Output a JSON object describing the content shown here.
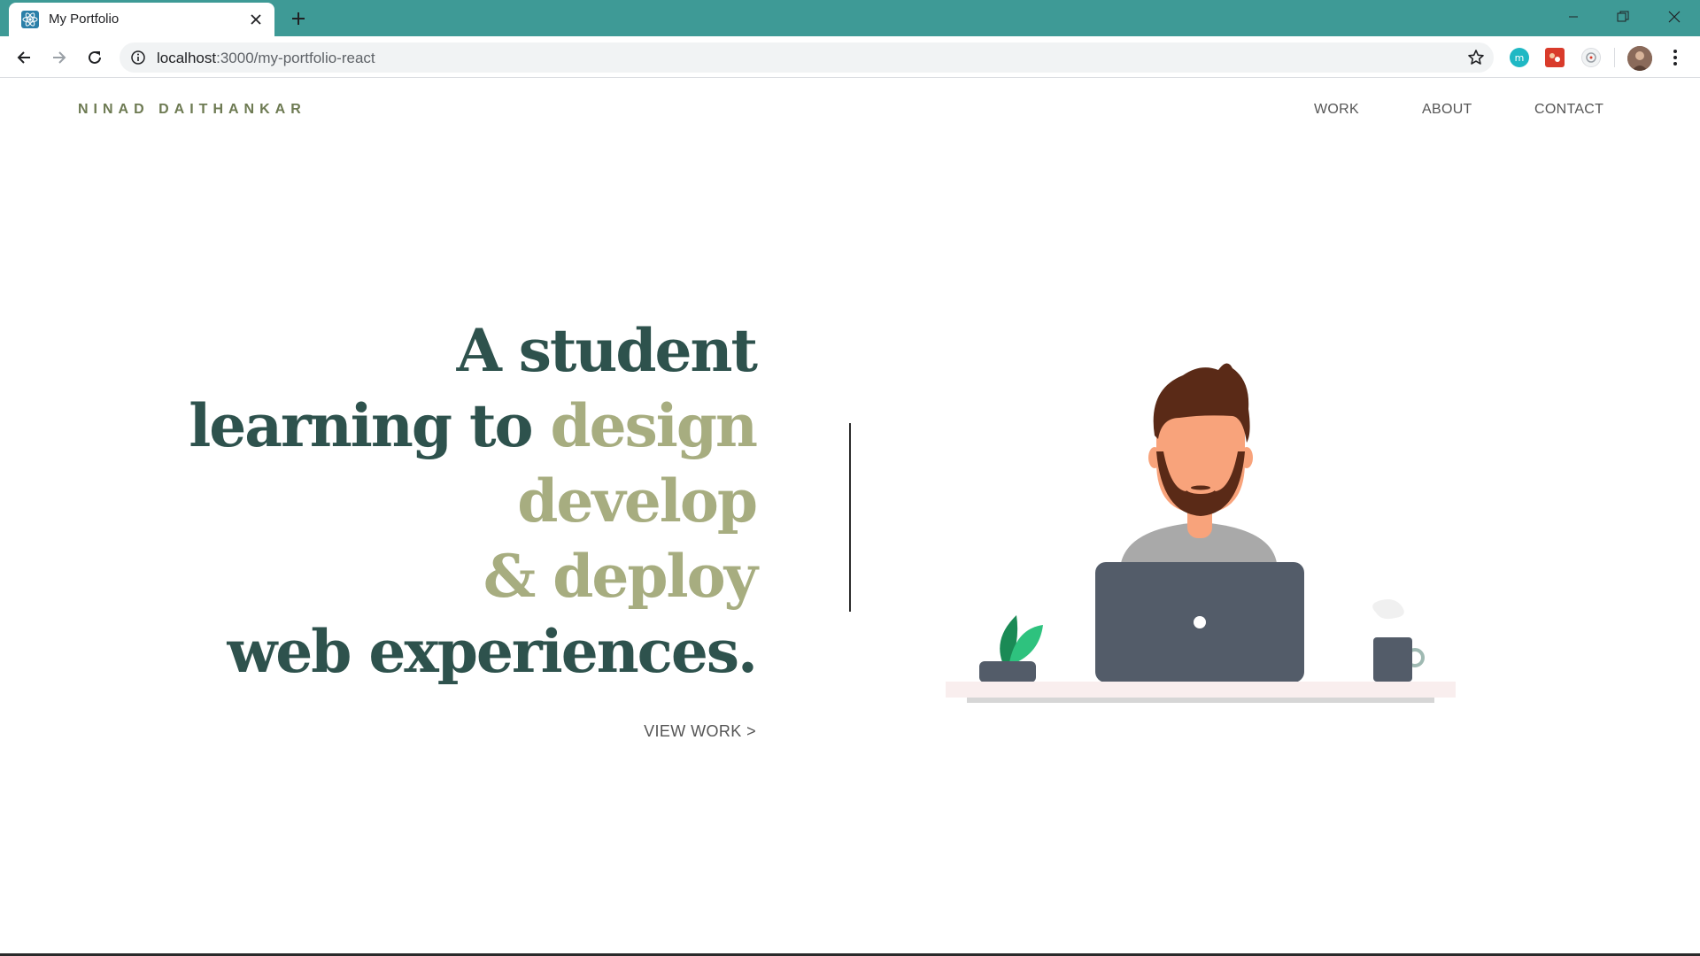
{
  "browser": {
    "tab_title": "My Portfolio",
    "url_host": "localhost",
    "url_path": ":3000/my-portfolio-react",
    "accent_color": "#3e9a96"
  },
  "site": {
    "brand": "NINAD DAITHANKAR",
    "nav": [
      {
        "label": "WORK"
      },
      {
        "label": "ABOUT"
      },
      {
        "label": "CONTACT"
      }
    ]
  },
  "hero": {
    "line1": "A student",
    "line2_plain": "learning to ",
    "line2_accent": "design",
    "line3_accent": "develop",
    "line4_accent": "& deploy",
    "line5": "web experiences.",
    "cta": "VIEW WORK >",
    "primary_color": "#2e524d",
    "accent_color": "#a7ad80"
  },
  "icons": {
    "tab_favicon": "react-icon",
    "back": "arrow-left-icon",
    "forward": "arrow-right-icon",
    "reload": "reload-icon",
    "info": "info-icon",
    "bookmark": "star-icon",
    "menu": "more-vert-icon"
  }
}
